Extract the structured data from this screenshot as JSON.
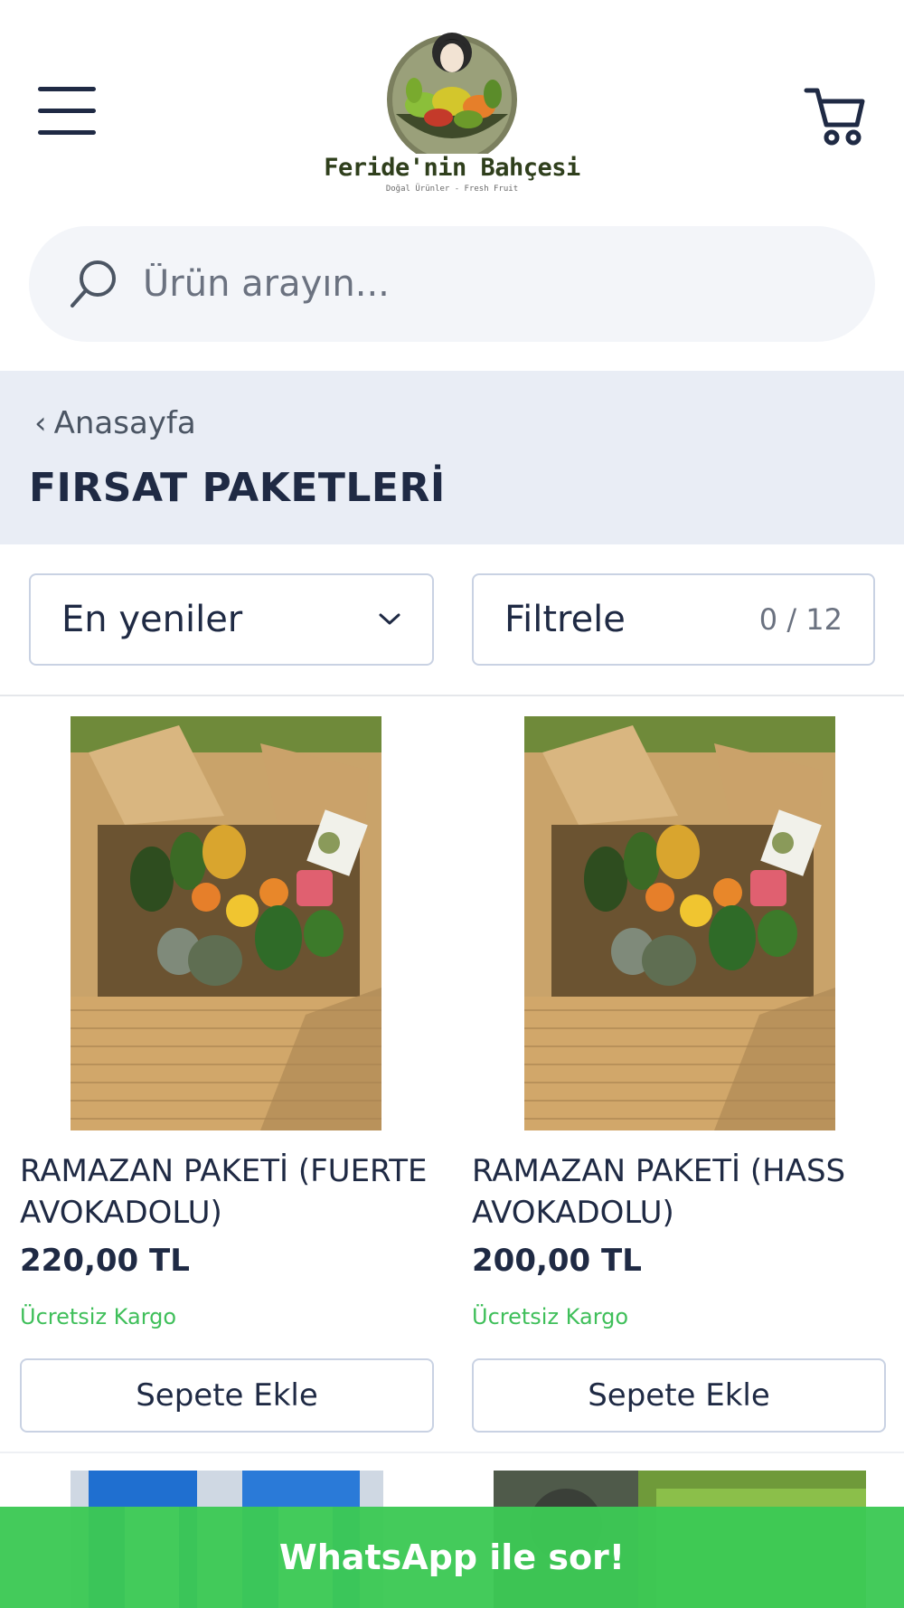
{
  "header": {
    "logo": {
      "name": "Feride'nin Bahçesi",
      "tagline": "Doğal Ürünler - Fresh Fruit"
    },
    "menu_icon": "hamburger-menu-icon",
    "cart_icon": "shopping-cart-icon"
  },
  "search": {
    "placeholder": "Ürün arayın...",
    "value": "",
    "icon": "search-icon"
  },
  "category": {
    "breadcrumb": "Anasayfa",
    "title": "FIRSAT PAKETLERİ"
  },
  "controls": {
    "sort_selected": "En yeniler",
    "filter_label": "Filtrele",
    "filter_count": "0 / 12"
  },
  "products": [
    {
      "name": "RAMAZAN PAKETİ (FUERTE AVOKADOLU)",
      "price": "220,00 TL",
      "shipping": "Ücretsiz Kargo",
      "button": "Sepete Ekle"
    },
    {
      "name": "RAMAZAN PAKETİ (HASS AVOKADOLU)",
      "price": "200,00 TL",
      "shipping": "Ücretsiz Kargo",
      "button": "Sepete Ekle"
    }
  ],
  "whatsapp": {
    "label": "WhatsApp ile sor!"
  },
  "colors": {
    "primary_text": "#1f2a44",
    "category_band": "#e9edf5",
    "free_shipping": "#3fbf5a",
    "whatsapp": "#3cc954",
    "search_bg": "#f3f5f9"
  }
}
